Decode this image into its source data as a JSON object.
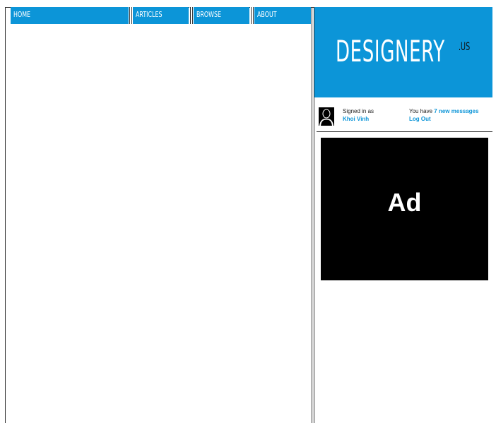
{
  "nav": {
    "items": [
      {
        "label": "HOME"
      },
      {
        "label": "ARTICLES"
      },
      {
        "label": "BROWSE"
      },
      {
        "label": "ABOUT"
      }
    ]
  },
  "logo": {
    "text": "DESIGNERY",
    "suffix": ".US"
  },
  "user_panel": {
    "signed_in_label": "Signed in as",
    "user_name": "Khoi Vinh",
    "messages_prefix": "You have ",
    "messages_link": "7 new messages",
    "logout_label": "Log Out",
    "avatar_icon": "user-silhouette-icon"
  },
  "ad": {
    "label": "Ad"
  },
  "colors": {
    "accent": "#0c95d8",
    "ad_background": "#000000",
    "frame": "#333333"
  }
}
